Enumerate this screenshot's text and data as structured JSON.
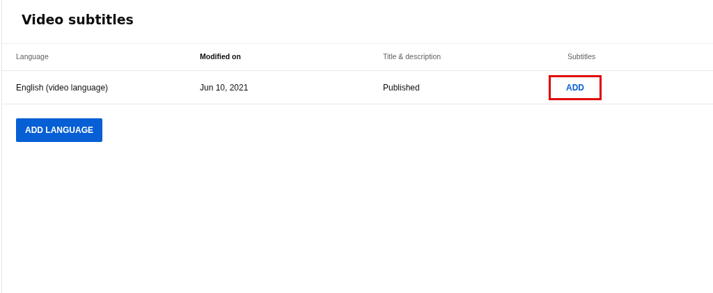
{
  "title": "Video subtitles",
  "table": {
    "columns": [
      {
        "label": "Language",
        "sorted": false
      },
      {
        "label": "Modified on",
        "sorted": true
      },
      {
        "label": "Title & description",
        "sorted": false
      },
      {
        "label": "Subtitles",
        "sorted": false
      }
    ],
    "rows": [
      {
        "cells": [
          {
            "kind": "text",
            "text": "English (video language)"
          },
          {
            "kind": "text",
            "text": "Jun 10, 2021"
          },
          {
            "kind": "text",
            "text": "Published"
          },
          {
            "kind": "action",
            "text": "ADD",
            "highlighted": true
          }
        ]
      }
    ]
  },
  "add_button": "ADD LANGUAGE"
}
